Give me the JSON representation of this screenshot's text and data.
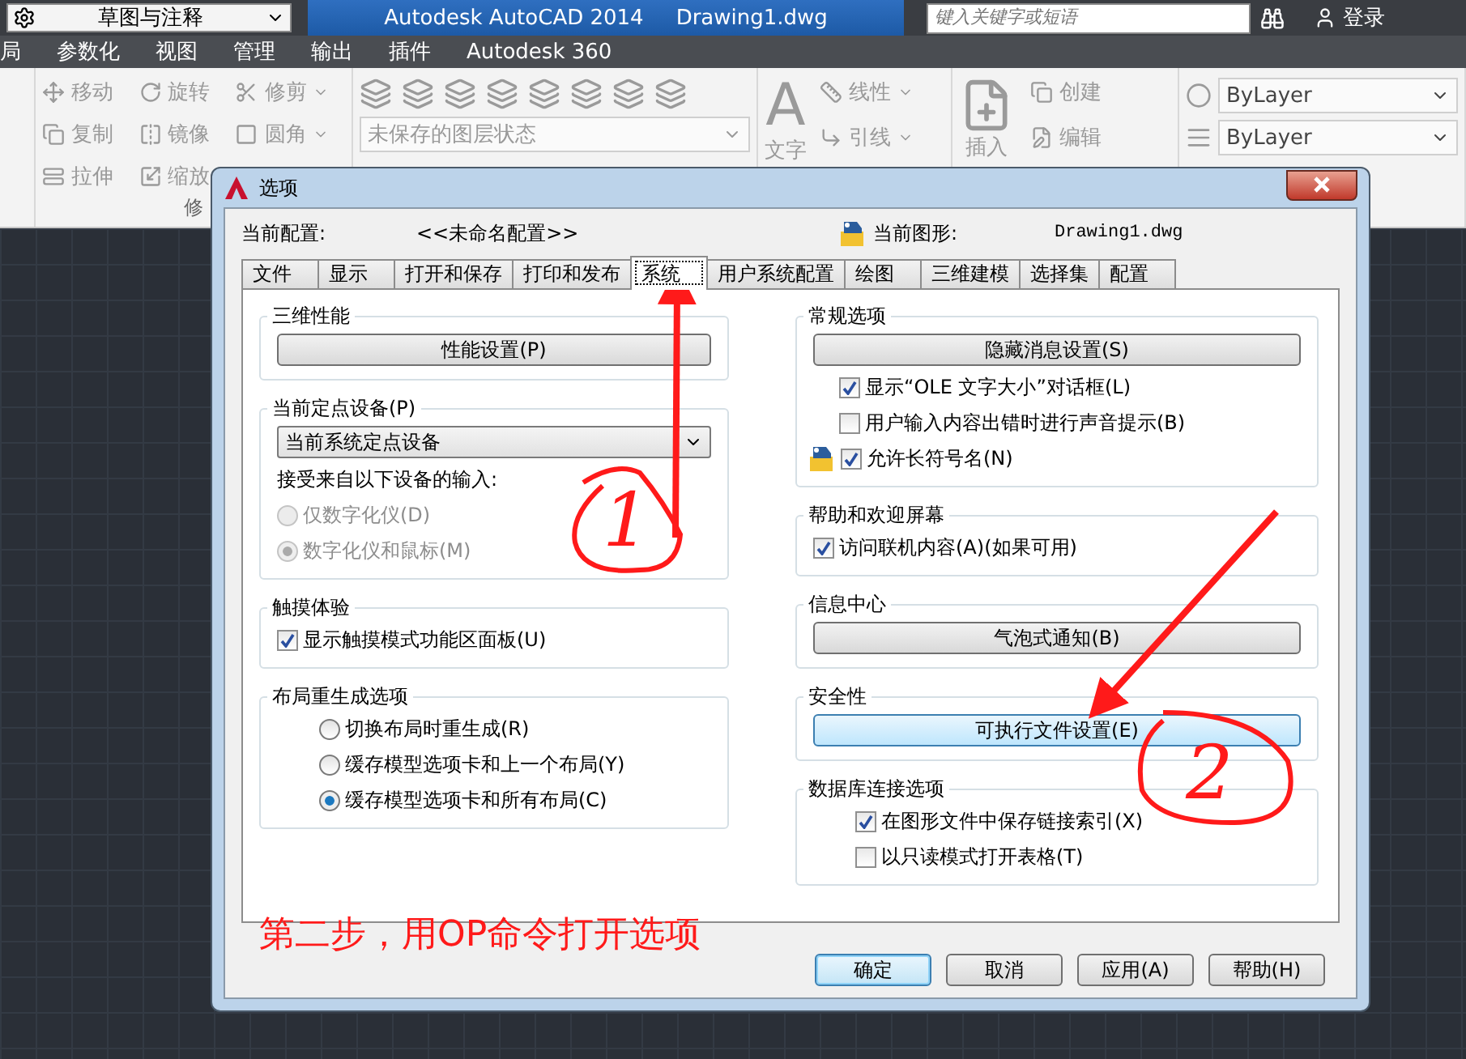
{
  "app_bar": {
    "workspace": "草图与注释",
    "title": "Autodesk AutoCAD 2014",
    "document": "Drawing1.dwg",
    "search": {
      "placeholder": "键入关键字或短语"
    },
    "sign_in": "登录"
  },
  "menu": [
    {
      "label": "局"
    },
    {
      "label": "参数化"
    },
    {
      "label": "视图"
    },
    {
      "label": "管理"
    },
    {
      "label": "输出"
    },
    {
      "label": "插件"
    },
    {
      "label": "Autodesk 360"
    }
  ],
  "ribbon": {
    "modify": {
      "title": "修",
      "tools": [
        {
          "label": "移动",
          "dropdown": false
        },
        {
          "label": "旋转",
          "dropdown": false
        },
        {
          "label": "修剪",
          "dropdown": true
        },
        {
          "label": "复制",
          "dropdown": false
        },
        {
          "label": "镜像",
          "dropdown": false
        },
        {
          "label": "圆角",
          "dropdown": true
        },
        {
          "label": "拉伸",
          "dropdown": false
        },
        {
          "label": "缩放",
          "dropdown": false
        }
      ]
    },
    "layers": {
      "state": "未保存的图层状态"
    },
    "annotation": {
      "glyph": "A",
      "big": "文字",
      "tools": [
        {
          "label": "线性"
        },
        {
          "label": "引线"
        }
      ]
    },
    "block": {
      "big": "插入",
      "tools": [
        {
          "label": "创建"
        },
        {
          "label": "编辑"
        }
      ]
    },
    "properties": {
      "dropdowns": [
        {
          "value": "ByLayer"
        },
        {
          "value": "ByLayer"
        }
      ]
    }
  },
  "dialog": {
    "title": "选项",
    "profile_label": "当前配置:",
    "profile": "<<未命名配置>>",
    "drawing_label": "当前图形:",
    "drawing": "Drawing1.dwg",
    "tabs": [
      {
        "label": "文件",
        "selected": false
      },
      {
        "label": "显示",
        "selected": false
      },
      {
        "label": "打开和保存",
        "selected": false
      },
      {
        "label": "打印和发布",
        "selected": false
      },
      {
        "label": "系统",
        "selected": true
      },
      {
        "label": "用户系统配置",
        "selected": false
      },
      {
        "label": "绘图",
        "selected": false
      },
      {
        "label": "三维建模",
        "selected": false
      },
      {
        "label": "选择集",
        "selected": false
      },
      {
        "label": "配置",
        "selected": false
      }
    ],
    "left": [
      {
        "title": "三维性能",
        "items": [
          {
            "kind": "button",
            "label": "性能设置(P)",
            "highlighted": false
          }
        ]
      },
      {
        "title": "当前定点设备(P)",
        "items": [
          {
            "kind": "dropdown",
            "value": "当前系统定点设备"
          },
          {
            "kind": "label",
            "text": "接受来自以下设备的输入:"
          },
          {
            "kind": "radio",
            "label": "仅数字化仪(D)",
            "selected": false,
            "disabled": true
          },
          {
            "kind": "radio",
            "label": "数字化仪和鼠标(M)",
            "selected": true,
            "disabled": true
          }
        ]
      },
      {
        "title": "触摸体验",
        "items": [
          {
            "kind": "checkbox",
            "label": "显示触摸模式功能区面板(U)",
            "checked": true
          }
        ]
      },
      {
        "title": "布局重生成选项",
        "items": [
          {
            "kind": "radio",
            "label": "切换布局时重生成(R)",
            "selected": false,
            "disabled": false
          },
          {
            "kind": "radio",
            "label": "缓存模型选项卡和上一个布局(Y)",
            "selected": false,
            "disabled": false
          },
          {
            "kind": "radio",
            "label": "缓存模型选项卡和所有布局(C)",
            "selected": true,
            "disabled": false
          }
        ]
      }
    ],
    "right": [
      {
        "title": "常规选项",
        "items": [
          {
            "kind": "button",
            "label": "隐藏消息设置(S)",
            "highlighted": false
          },
          {
            "kind": "checkbox",
            "label": "显示“OLE 文字大小”对话框(L)",
            "checked": true,
            "saved_in_drawing": false
          },
          {
            "kind": "checkbox",
            "label": "用户输入内容出错时进行声音提示(B)",
            "checked": false,
            "saved_in_drawing": false
          },
          {
            "kind": "checkbox",
            "label": "允许长符号名(N)",
            "checked": true,
            "saved_in_drawing": true
          }
        ]
      },
      {
        "title": "帮助和欢迎屏幕",
        "items": [
          {
            "kind": "checkbox",
            "label": "访问联机内容(A)(如果可用)",
            "checked": true
          }
        ]
      },
      {
        "title": "信息中心",
        "items": [
          {
            "kind": "button",
            "label": "气泡式通知(B)",
            "highlighted": false
          }
        ]
      },
      {
        "title": "安全性",
        "items": [
          {
            "kind": "button",
            "label": "可执行文件设置(E)",
            "highlighted": true
          }
        ]
      },
      {
        "title": "数据库连接选项",
        "items": [
          {
            "kind": "checkbox",
            "label": "在图形文件中保存链接索引(X)",
            "checked": true
          },
          {
            "kind": "checkbox",
            "label": "以只读模式打开表格(T)",
            "checked": false
          }
        ]
      }
    ],
    "buttons": [
      {
        "label": "确定",
        "default": true
      },
      {
        "label": "取消",
        "default": false
      },
      {
        "label": "应用(A)",
        "default": false
      },
      {
        "label": "帮助(H)",
        "default": false
      }
    ]
  },
  "annotations": {
    "step_text": "第二步，用OP命令打开选项",
    "marks": [
      {
        "label": "1"
      },
      {
        "label": "2"
      }
    ]
  }
}
